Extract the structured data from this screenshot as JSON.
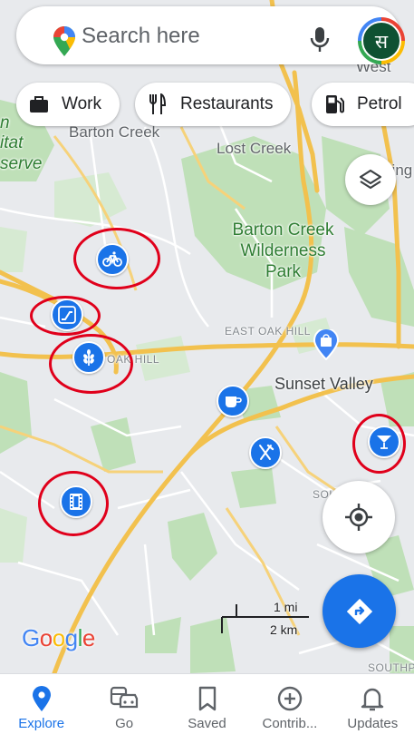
{
  "search": {
    "placeholder": "Search here"
  },
  "account": {
    "avatar_initial": "स"
  },
  "chips": [
    {
      "label": "Work",
      "icon": "briefcase-icon"
    },
    {
      "label": "Restaurants",
      "icon": "fork-knife-icon"
    },
    {
      "label": "Petrol",
      "icon": "fuel-pump-icon"
    }
  ],
  "map_labels": {
    "barton_creek": "Barton Creek",
    "lost_creek": "Lost Creek",
    "wilderness_park": "Barton Creek\nWilderness\nPark",
    "east_oak_hill": "EAST OAK HILL",
    "oak_hill": "OAK HILL",
    "sunset_valley": "Sunset Valley",
    "west": "West",
    "edge_n": "n",
    "edge_itat": "itat",
    "edge_serve": "serve",
    "edge_lling": "lling",
    "south_n": "SOUTH      N",
    "southp": "SOUTHP"
  },
  "pois": [
    {
      "name": "bike-poi",
      "icon": "bicycle-icon",
      "circled": true
    },
    {
      "name": "escalator-poi",
      "icon": "escalator-icon",
      "circled": true
    },
    {
      "name": "wheat-poi",
      "icon": "wheat-icon",
      "circled": true
    },
    {
      "name": "cafe-poi",
      "icon": "coffee-cup-icon",
      "circled": false
    },
    {
      "name": "restaurant-poi",
      "icon": "fork-knife-icon",
      "circled": false
    },
    {
      "name": "bar-poi",
      "icon": "cocktail-icon",
      "circled": true
    },
    {
      "name": "cinema-poi",
      "icon": "film-icon",
      "circled": true
    }
  ],
  "scale": {
    "miles": "1 mi",
    "km": "2 km"
  },
  "google_logo": [
    "G",
    "o",
    "o",
    "g",
    "l",
    "e"
  ],
  "colors": {
    "accent": "#1a73e8",
    "annotation": "#e0001b",
    "park": "#b5dbb0",
    "road": "#f6c347"
  },
  "nav": [
    {
      "label": "Explore",
      "icon": "location-pin-icon",
      "active": true
    },
    {
      "label": "Go",
      "icon": "car-transit-icon",
      "active": false
    },
    {
      "label": "Saved",
      "icon": "bookmark-icon",
      "active": false
    },
    {
      "label": "Contrib...",
      "icon": "add-circle-icon",
      "active": false
    },
    {
      "label": "Updates",
      "icon": "bell-icon",
      "active": false
    }
  ]
}
